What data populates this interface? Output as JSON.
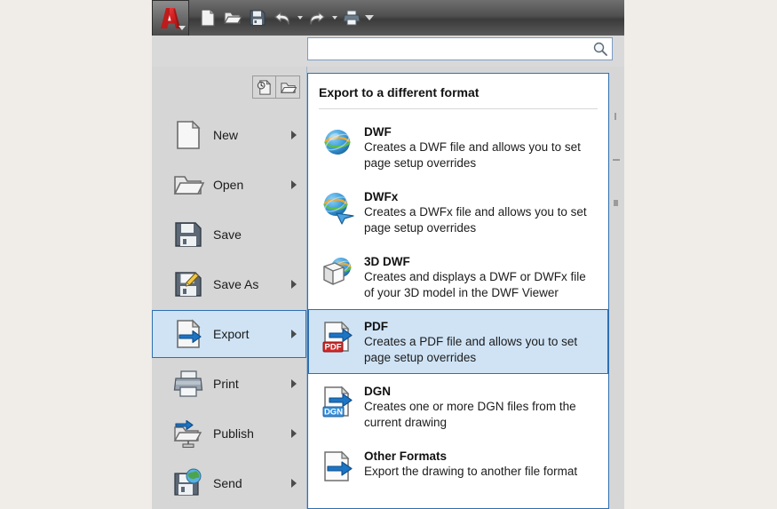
{
  "window": {
    "app_button_icon": "autocad-a-logo",
    "app_button_caret": "chevron-down-icon"
  },
  "quick_access_toolbar": {
    "buttons": [
      {
        "name": "new-document-icon",
        "label": "New"
      },
      {
        "name": "open-folder-icon",
        "label": "Open"
      },
      {
        "name": "save-floppy-icon",
        "label": "Save"
      },
      {
        "name": "undo-arrow-icon",
        "label": "Undo"
      },
      {
        "name": "undo-dropdown-caret-icon",
        "label": "Undo options"
      },
      {
        "name": "redo-arrow-icon",
        "label": "Redo"
      },
      {
        "name": "redo-dropdown-caret-icon",
        "label": "Redo options"
      },
      {
        "name": "print-icon",
        "label": "Plot"
      },
      {
        "name": "qat-customize-caret-icon",
        "label": "Customize Quick Access Toolbar"
      }
    ]
  },
  "search": {
    "value": "",
    "placeholder": "",
    "icon": "search-magnifier-icon"
  },
  "document_toggles": [
    {
      "name": "recent-documents-icon",
      "label": "Recent Documents"
    },
    {
      "name": "open-documents-icon",
      "label": "Open Documents"
    }
  ],
  "sidebar": {
    "items": [
      {
        "label": "New",
        "icon": "new-document-icon",
        "has_submenu": true,
        "selected": false
      },
      {
        "label": "Open",
        "icon": "open-folder-icon",
        "has_submenu": true,
        "selected": false
      },
      {
        "label": "Save",
        "icon": "save-floppy-icon",
        "has_submenu": false,
        "selected": false
      },
      {
        "label": "Save As",
        "icon": "save-as-icon",
        "has_submenu": true,
        "selected": false
      },
      {
        "label": "Export",
        "icon": "export-icon",
        "has_submenu": true,
        "selected": true
      },
      {
        "label": "Print",
        "icon": "printer-icon",
        "has_submenu": true,
        "selected": false
      },
      {
        "label": "Publish",
        "icon": "publish-icon",
        "has_submenu": true,
        "selected": false
      },
      {
        "label": "Send",
        "icon": "send-icon",
        "has_submenu": true,
        "selected": false
      }
    ]
  },
  "submenu": {
    "title": "Export to a different format",
    "items": [
      {
        "title": "DWF",
        "description": "Creates a DWF file and allows you to set page setup overrides",
        "icon": "dwf-globe-icon",
        "selected": false
      },
      {
        "title": "DWFx",
        "description": "Creates a DWFx file and allows you to set page setup overrides",
        "icon": "dwfx-globe-cursor-icon",
        "selected": false
      },
      {
        "title": "3D DWF",
        "description": "Creates and displays a DWF or DWFx file of your 3D model in the DWF Viewer",
        "icon": "3d-dwf-cube-globe-icon",
        "selected": false
      },
      {
        "title": "PDF",
        "description": "Creates a PDF file and allows you to set page setup overrides",
        "icon": "pdf-page-arrow-icon",
        "selected": true
      },
      {
        "title": "DGN",
        "description": "Creates one or more DGN files from the current drawing",
        "icon": "dgn-page-arrow-icon",
        "selected": false
      },
      {
        "title": "Other Formats",
        "description": "Export the drawing to another file format",
        "icon": "other-formats-page-arrow-icon",
        "selected": false
      }
    ]
  },
  "colors": {
    "accent_blue": "#2f6faf",
    "selection_fill": "#cfe3f5",
    "desktop": "#f0ede9",
    "panel_gray": "#d6d6d6",
    "pdf_red": "#cf2a2a",
    "dgn_blue": "#3a8fd8",
    "arrow_blue": "#1c74c4"
  }
}
